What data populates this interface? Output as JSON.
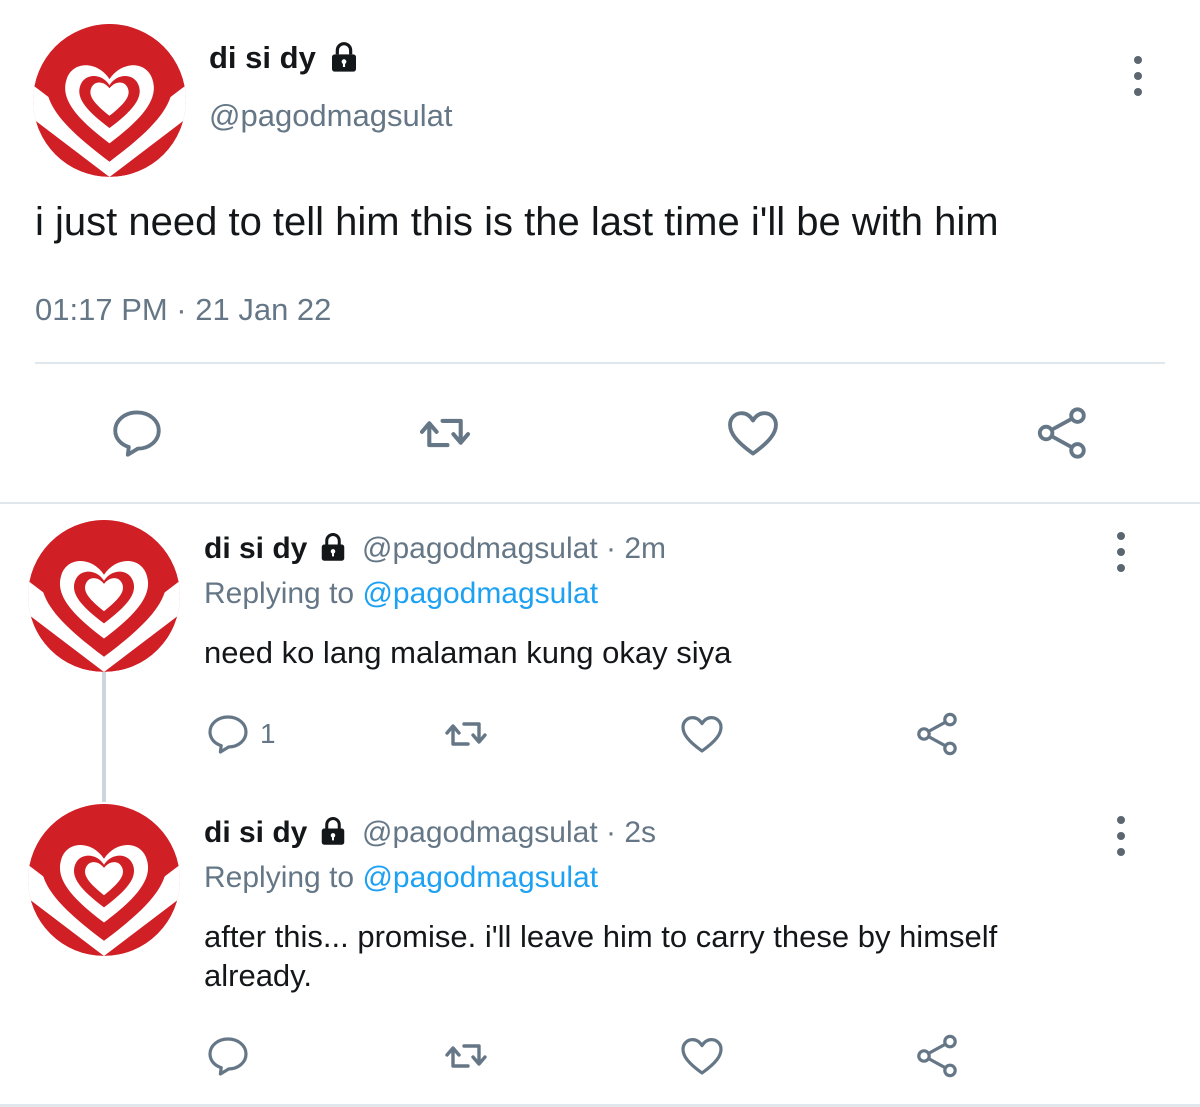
{
  "main_tweet": {
    "display_name": "di si dy",
    "handle": "@pagodmagsulat",
    "text": "i just need to tell him this is the last time i'll be with him",
    "timestamp": "01:17 PM · 21 Jan 22",
    "lock_icon": "lock-icon",
    "more_icon": "more-vertical-icon"
  },
  "replies": [
    {
      "display_name": "di si dy",
      "handle_time": "@pagodmagsulat · 2m",
      "replying_label": "Replying to",
      "replying_to": "@pagodmagsulat",
      "text_lines": [
        "need ko lang malaman kung okay siya"
      ],
      "reply_count": "1"
    },
    {
      "display_name": "di si dy",
      "handle_time": "@pagodmagsulat · 2s",
      "replying_label": "Replying to",
      "replying_to": "@pagodmagsulat",
      "text_lines": [
        "after this... promise. i'll leave him to carry these by himself",
        "already."
      ],
      "reply_count": ""
    }
  ],
  "icons": {
    "reply": "reply-icon",
    "retweet": "retweet-icon",
    "like": "heart-icon",
    "share": "share-icon"
  },
  "colors": {
    "accent_link": "#1da1f2",
    "secondary_text": "#657786",
    "icon_stroke": "#657786",
    "avatar_red": "#d11f26"
  }
}
